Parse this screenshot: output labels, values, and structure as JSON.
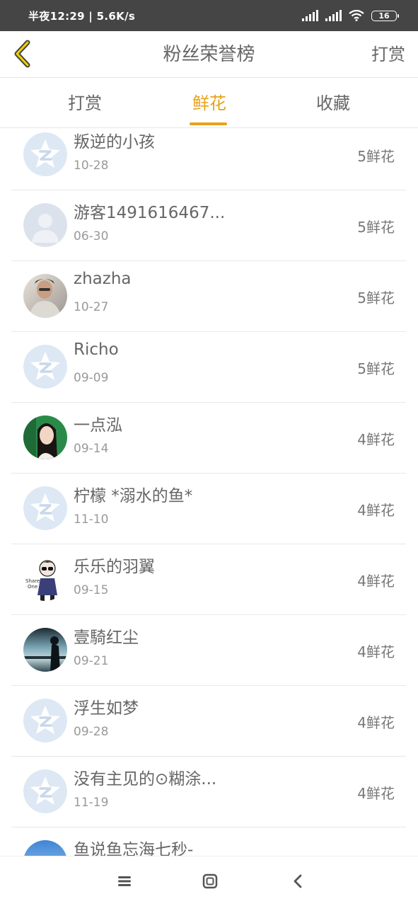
{
  "status_bar": {
    "time": "半夜12:29 | 5.6K/s",
    "battery": "16"
  },
  "header": {
    "title": "粉丝荣誉榜",
    "action": "打赏"
  },
  "tabs": [
    {
      "label": "打赏",
      "active": false
    },
    {
      "label": "鲜花",
      "active": true
    },
    {
      "label": "收藏",
      "active": false
    }
  ],
  "colors": {
    "accent": "#e6a21c",
    "status_bar": "#454545"
  },
  "fans": [
    {
      "name": "叛逆的小孩",
      "date": "10-28",
      "count": "5鲜花",
      "avatar": "default-qq-icon"
    },
    {
      "name": "游客1491616467...",
      "date": "06-30",
      "count": "5鲜花",
      "avatar": "guest-silhouette-icon"
    },
    {
      "name": "zhazha",
      "date": "10-27",
      "count": "5鲜花",
      "avatar": "photo-man"
    },
    {
      "name": "Richo",
      "date": "09-09",
      "count": "5鲜花",
      "avatar": "default-qq-icon"
    },
    {
      "name": "一点泓",
      "date": "09-14",
      "count": "4鲜花",
      "avatar": "photo-girl-green"
    },
    {
      "name": "柠檬 *溺水的鱼*",
      "date": "11-10",
      "count": "4鲜花",
      "avatar": "default-qq-icon"
    },
    {
      "name": "乐乐的羽翼",
      "date": "09-15",
      "count": "4鲜花",
      "avatar": "cartoon-boy"
    },
    {
      "name": "壹騎红尘",
      "date": "09-21",
      "count": "4鲜花",
      "avatar": "photo-sea-silhouette"
    },
    {
      "name": "浮生如梦",
      "date": "09-28",
      "count": "4鲜花",
      "avatar": "default-qq-icon"
    },
    {
      "name": "没有主见的⊙糊涂...",
      "date": "11-19",
      "count": "4鲜花",
      "avatar": "default-qq-icon"
    },
    {
      "name": "鱼说鱼忘海七秒-",
      "date": "",
      "count": "",
      "avatar": "photo-blue-sky"
    }
  ]
}
